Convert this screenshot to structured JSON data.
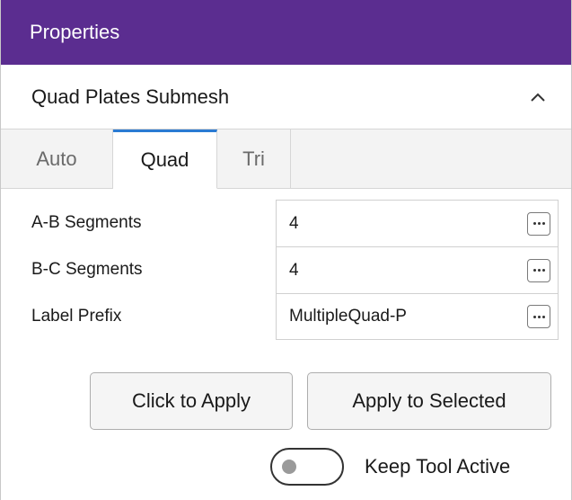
{
  "header": {
    "title": "Properties"
  },
  "section": {
    "title": "Quad Plates Submesh",
    "collapse_icon": "chevron-up-icon"
  },
  "tabs": [
    {
      "label": "Auto",
      "active": false
    },
    {
      "label": "Quad",
      "active": true
    },
    {
      "label": "Tri",
      "active": false
    }
  ],
  "properties": [
    {
      "label": "A-B Segments",
      "value": "4"
    },
    {
      "label": "B-C Segments",
      "value": "4"
    },
    {
      "label": "Label Prefix",
      "value": "MultipleQuad-P"
    }
  ],
  "buttons": {
    "apply": "Click to Apply",
    "apply_selected": "Apply to Selected"
  },
  "toggle": {
    "label": "Keep Tool Active",
    "on": false
  },
  "colors": {
    "header_bg": "#5b2d90",
    "active_tab_accent": "#2a7bd3"
  }
}
